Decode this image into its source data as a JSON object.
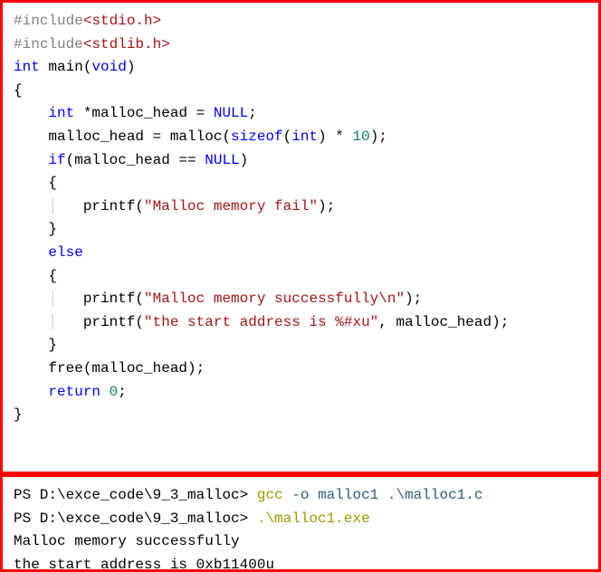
{
  "code": {
    "pp1_hash": "#",
    "pp1_inc": "include",
    "pp1_open": "<",
    "pp1_hdr": "stdio.h",
    "pp1_close": ">",
    "pp2_hash": "#",
    "pp2_inc": "include",
    "pp2_open": "<",
    "pp2_hdr": "stdlib.h",
    "pp2_close": ">",
    "kw_int": "int",
    "id_main": " main",
    "p_open": "(",
    "kw_void": "void",
    "p_close": ")",
    "brace_open": "{",
    "l5_kw": "int",
    "l5_rest1": " *malloc_head = ",
    "l5_null": "NULL",
    "l5_semi": ";",
    "l6_a": "malloc_head = malloc(",
    "l6_sizeof": "sizeof",
    "l6_b": "(",
    "l6_int": "int",
    "l6_c": ") * ",
    "l6_num": "10",
    "l6_d": ");",
    "l7_if": "if",
    "l7_a": "(malloc_head == ",
    "l7_null": "NULL",
    "l7_b": ")",
    "l8_brace": "{",
    "l9_a": "printf(",
    "l9_str": "\"Malloc memory fail\"",
    "l9_b": ");",
    "l10_brace": "}",
    "l11_else": "else",
    "l12_brace": "{",
    "l13_a": "printf(",
    "l13_str": "\"Malloc memory successfully\\n\"",
    "l13_b": ");",
    "l14_a": "printf(",
    "l14_str": "\"the start address is %#xu\"",
    "l14_b": ", malloc_head);",
    "l15_brace": "}",
    "l16": "free(malloc_head);",
    "l17_ret": "return",
    "l17_sp": " ",
    "l17_num": "0",
    "l17_semi": ";",
    "brace_close": "}",
    "indent1": "    ",
    "indent2": "        ",
    "guide1": "│   ",
    "guide2": "│   │   "
  },
  "term": {
    "ps1": "PS D:\\exce_code\\9_3_malloc> ",
    "cmd1": "gcc",
    "args1": " -o malloc1 .\\malloc1.c",
    "ps2": "PS D:\\exce_code\\9_3_malloc> ",
    "cmd2": ".\\malloc1.exe",
    "out1": "Malloc memory successfully",
    "out2": "the start address is 0xb11400u"
  }
}
